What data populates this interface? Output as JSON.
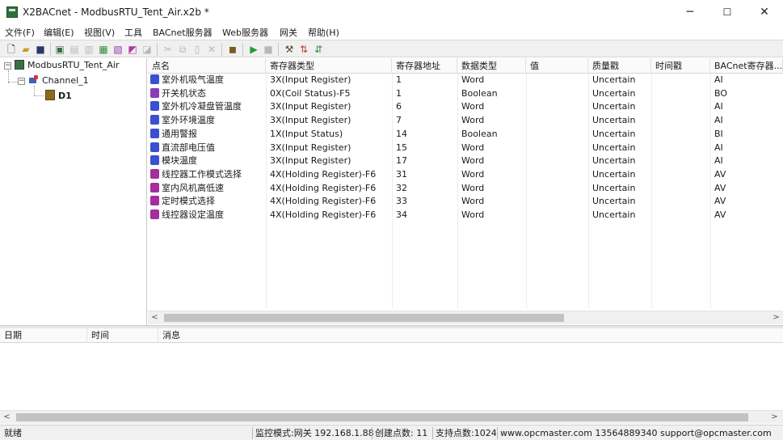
{
  "window": {
    "title": "X2BACnet - ModbusRTU_Tent_Air.x2b *",
    "controls": {
      "minimize": "─",
      "maximize": "☐",
      "close": "✕"
    }
  },
  "menu": [
    "文件(F)",
    "编辑(E)",
    "视图(V)",
    "工具",
    "BACnet服务器",
    "Web服务器",
    "网关",
    "帮助(H)"
  ],
  "toolbar": {
    "icons": [
      "new-file-icon",
      "open-folder-icon",
      "save-icon",
      "add-channel-icon",
      "add-device-icon",
      "add-point-icon",
      "import-icon",
      "export-icon",
      "properties-icon",
      "cut-icon",
      "copy-icon",
      "paste-icon",
      "delete-icon",
      "monitor-icon",
      "run-icon",
      "stop-icon",
      "tools-icon",
      "gateway-icon",
      "sync-icon"
    ]
  },
  "tree": {
    "root": "ModbusRTU_Tent_Air",
    "channel": "Channel_1",
    "device": "D1"
  },
  "grid": {
    "columns": [
      "点名",
      "寄存器类型",
      "寄存器地址",
      "数据类型",
      "值",
      "质量戳",
      "时间戳",
      "BACnet寄存器..."
    ],
    "rows": [
      {
        "type_icon": "ai",
        "name": "室外机吸气温度",
        "reg_type": "3X(Input Register)",
        "addr": "1",
        "dtype": "Word",
        "value": "",
        "quality": "Uncertain",
        "time": "",
        "bacnet": "AI"
      },
      {
        "type_icon": "bo",
        "name": "开关机状态",
        "reg_type": "0X(Coil Status)-F5",
        "addr": "1",
        "dtype": "Boolean",
        "value": "",
        "quality": "Uncertain",
        "time": "",
        "bacnet": "BO"
      },
      {
        "type_icon": "ai",
        "name": "室外机冷凝盘管温度",
        "reg_type": "3X(Input Register)",
        "addr": "6",
        "dtype": "Word",
        "value": "",
        "quality": "Uncertain",
        "time": "",
        "bacnet": "AI"
      },
      {
        "type_icon": "ai",
        "name": "室外环境温度",
        "reg_type": "3X(Input Register)",
        "addr": "7",
        "dtype": "Word",
        "value": "",
        "quality": "Uncertain",
        "time": "",
        "bacnet": "AI"
      },
      {
        "type_icon": "ai",
        "name": "通用警报",
        "reg_type": "1X(Input Status)",
        "addr": "14",
        "dtype": "Boolean",
        "value": "",
        "quality": "Uncertain",
        "time": "",
        "bacnet": "BI"
      },
      {
        "type_icon": "ai",
        "name": "直流部电压值",
        "reg_type": "3X(Input Register)",
        "addr": "15",
        "dtype": "Word",
        "value": "",
        "quality": "Uncertain",
        "time": "",
        "bacnet": "AI"
      },
      {
        "type_icon": "ai",
        "name": "模块温度",
        "reg_type": "3X(Input Register)",
        "addr": "17",
        "dtype": "Word",
        "value": "",
        "quality": "Uncertain",
        "time": "",
        "bacnet": "AI"
      },
      {
        "type_icon": "av",
        "name": "线控器工作模式选择",
        "reg_type": "4X(Holding Register)-F6",
        "addr": "31",
        "dtype": "Word",
        "value": "",
        "quality": "Uncertain",
        "time": "",
        "bacnet": "AV"
      },
      {
        "type_icon": "av",
        "name": "室内风机高低速",
        "reg_type": "4X(Holding Register)-F6",
        "addr": "32",
        "dtype": "Word",
        "value": "",
        "quality": "Uncertain",
        "time": "",
        "bacnet": "AV"
      },
      {
        "type_icon": "av",
        "name": "定时模式选择",
        "reg_type": "4X(Holding Register)-F6",
        "addr": "33",
        "dtype": "Word",
        "value": "",
        "quality": "Uncertain",
        "time": "",
        "bacnet": "AV"
      },
      {
        "type_icon": "av",
        "name": "线控器设定温度",
        "reg_type": "4X(Holding Register)-F6",
        "addr": "34",
        "dtype": "Word",
        "value": "",
        "quality": "Uncertain",
        "time": "",
        "bacnet": "AV"
      }
    ]
  },
  "log": {
    "columns": [
      "日期",
      "时间",
      "消息"
    ]
  },
  "scroll": {
    "left_arrow": "<",
    "right_arrow": ">"
  },
  "status": {
    "ready": "就绪",
    "mode": "监控模式:网关 192.168.1.88",
    "created": "创建点数: 11",
    "supported": "支持点数:1024",
    "contact": "www.opcmaster.com 13564889340 support@opcmaster.com"
  },
  "colors": {
    "ai_icon": "#3b4fd0",
    "bo_icon": "#8b3bb8",
    "av_icon": "#a52e9c",
    "run": "#1f9d2f"
  }
}
